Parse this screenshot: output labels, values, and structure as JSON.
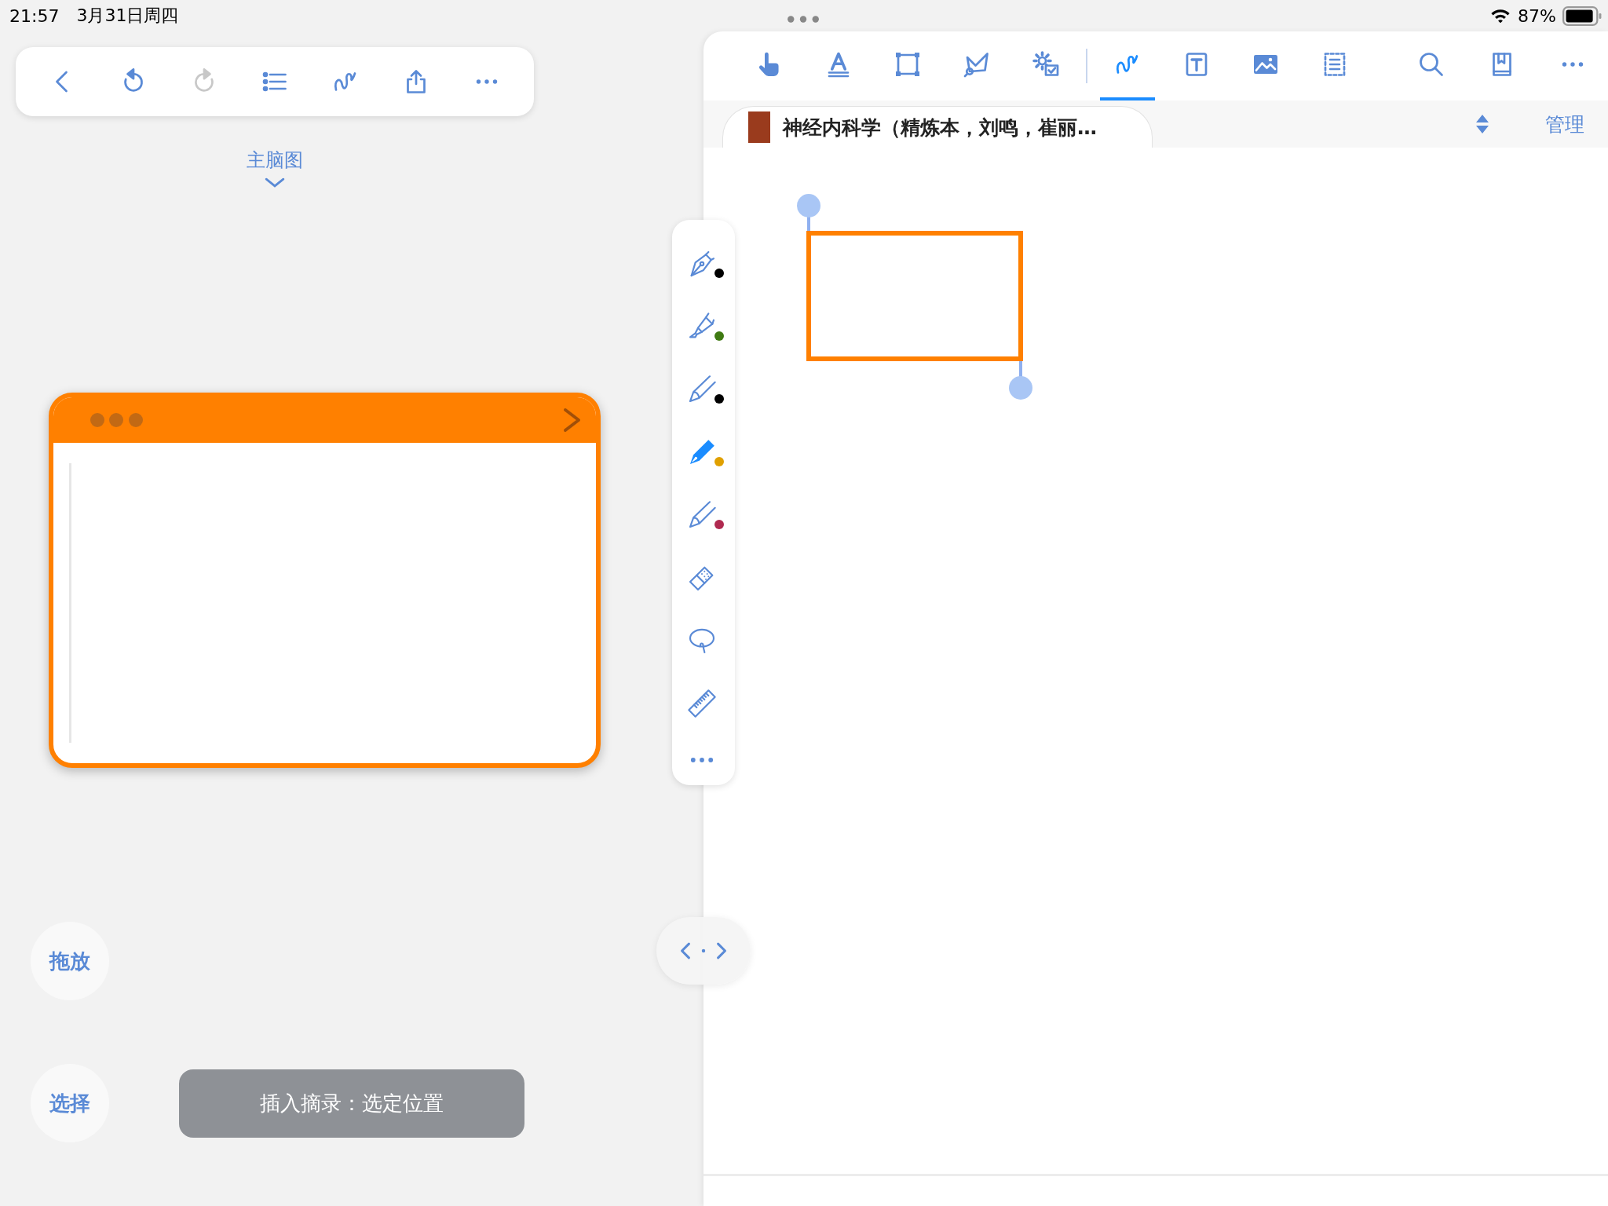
{
  "status_bar": {
    "time": "21:57",
    "date": "3月31日周四",
    "battery": "87%"
  },
  "left_toolbar": [
    {
      "kind": "back",
      "disabled": false
    },
    {
      "kind": "undo",
      "disabled": false
    },
    {
      "kind": "redo",
      "disabled": true
    },
    {
      "kind": "list",
      "disabled": false
    },
    {
      "kind": "scribble",
      "disabled": false
    },
    {
      "kind": "share",
      "disabled": false
    },
    {
      "kind": "more",
      "disabled": false
    }
  ],
  "mindmap": {
    "title": "主脑图"
  },
  "side_buttons": [
    {
      "label": "拖放"
    },
    {
      "label": "选择"
    }
  ],
  "toast": "插入摘录：选定位置",
  "pen_tools": [
    {
      "kind": "fountain-pen",
      "color": "#000000",
      "selected": false
    },
    {
      "kind": "highlighter",
      "color": "#3f7a12",
      "selected": false
    },
    {
      "kind": "pencil",
      "color": "#000000",
      "selected": false
    },
    {
      "kind": "pencil",
      "color": "#e0a000",
      "selected": true
    },
    {
      "kind": "pencil",
      "color": "#b02a50",
      "selected": false
    },
    {
      "kind": "eraser",
      "selected": false
    },
    {
      "kind": "lasso",
      "selected": false
    },
    {
      "kind": "ruler",
      "selected": false
    },
    {
      "kind": "more",
      "selected": false
    }
  ],
  "right_toolbar": {
    "tools": [
      {
        "kind": "hand",
        "selected": false
      },
      {
        "kind": "text-style",
        "selected": false
      },
      {
        "kind": "select-rect",
        "selected": false
      },
      {
        "kind": "shape",
        "selected": false
      },
      {
        "kind": "gear",
        "selected": false
      },
      {
        "kind": "scribble",
        "selected": true
      },
      {
        "kind": "textbox",
        "selected": false
      },
      {
        "kind": "image",
        "selected": false
      },
      {
        "kind": "dashed-list",
        "selected": false
      }
    ],
    "actions": [
      {
        "kind": "search"
      },
      {
        "kind": "bookmark"
      },
      {
        "kind": "more"
      }
    ]
  },
  "document_tab": {
    "title": "神经内科学（精炼本，刘鸣，崔丽…"
  },
  "manage": "管理"
}
